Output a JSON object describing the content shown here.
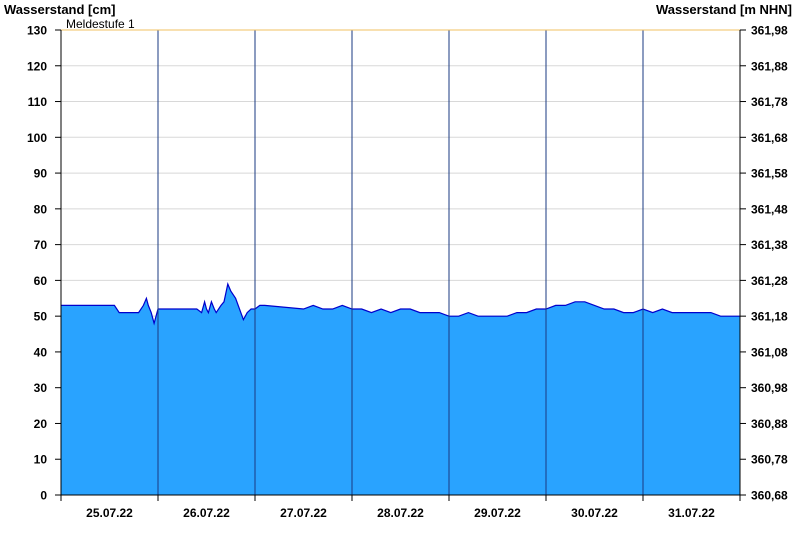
{
  "chart_data": {
    "type": "area",
    "left_axis_title": "Wasserstand [cm]",
    "right_axis_title": "Wasserstand [m NHN]",
    "ylim": [
      0,
      130
    ],
    "y_ticks": [
      0,
      10,
      20,
      30,
      40,
      50,
      60,
      70,
      80,
      90,
      100,
      110,
      120,
      130
    ],
    "right_tick_labels": [
      "360,68",
      "360,78",
      "360,88",
      "360,98",
      "361,08",
      "361,18",
      "361,28",
      "361,38",
      "361,48",
      "361,58",
      "361,68",
      "361,78",
      "361,88",
      "361,98"
    ],
    "x_labels": [
      "25.07.22",
      "26.07.22",
      "27.07.22",
      "28.07.22",
      "29.07.22",
      "30.07.22",
      "31.07.22"
    ],
    "xlim_days": [
      0,
      7
    ],
    "threshold": {
      "label": "Meldestufe 1",
      "value": 130,
      "color": "#f0c060"
    },
    "grid": true,
    "fill_color": "#29a3ff",
    "line_color": "#0000cc",
    "series": [
      {
        "x": [
          0,
          0.55,
          0.6,
          0.65,
          0.8,
          0.85,
          0.88,
          0.9,
          0.93,
          0.96,
          1.0,
          1.05,
          1.1,
          1.4,
          1.45,
          1.48,
          1.5,
          1.52,
          1.55,
          1.58,
          1.6,
          1.65,
          1.68,
          1.72,
          1.75,
          1.8,
          1.84,
          1.88,
          1.92,
          1.96,
          2.0,
          2.05,
          2.1,
          2.5,
          2.6,
          2.7,
          2.8,
          2.9,
          3.0,
          3.1,
          3.2,
          3.3,
          3.4,
          3.5,
          3.6,
          3.7,
          3.8,
          3.9,
          4.0,
          4.1,
          4.2,
          4.3,
          4.4,
          4.5,
          4.6,
          4.7,
          4.8,
          4.9,
          5.0,
          5.1,
          5.2,
          5.3,
          5.4,
          5.5,
          5.6,
          5.7,
          5.8,
          5.9,
          6.0,
          6.1,
          6.2,
          6.3,
          6.4,
          6.5,
          6.6,
          6.7,
          6.8,
          6.9,
          7.0
        ],
        "y": [
          53,
          53,
          51,
          51,
          51,
          53,
          55,
          53,
          51,
          48,
          52,
          52,
          52,
          52,
          51,
          54,
          52,
          51,
          54,
          52,
          51,
          53,
          54,
          59,
          57,
          55,
          52,
          49,
          51,
          52,
          52,
          53,
          53,
          52,
          53,
          52,
          52,
          53,
          52,
          52,
          51,
          52,
          51,
          52,
          52,
          51,
          51,
          51,
          50,
          50,
          51,
          50,
          50,
          50,
          50,
          51,
          51,
          52,
          52,
          53,
          53,
          54,
          54,
          53,
          52,
          52,
          51,
          51,
          52,
          51,
          52,
          51,
          51,
          51,
          51,
          51,
          50,
          50,
          50
        ]
      }
    ]
  }
}
